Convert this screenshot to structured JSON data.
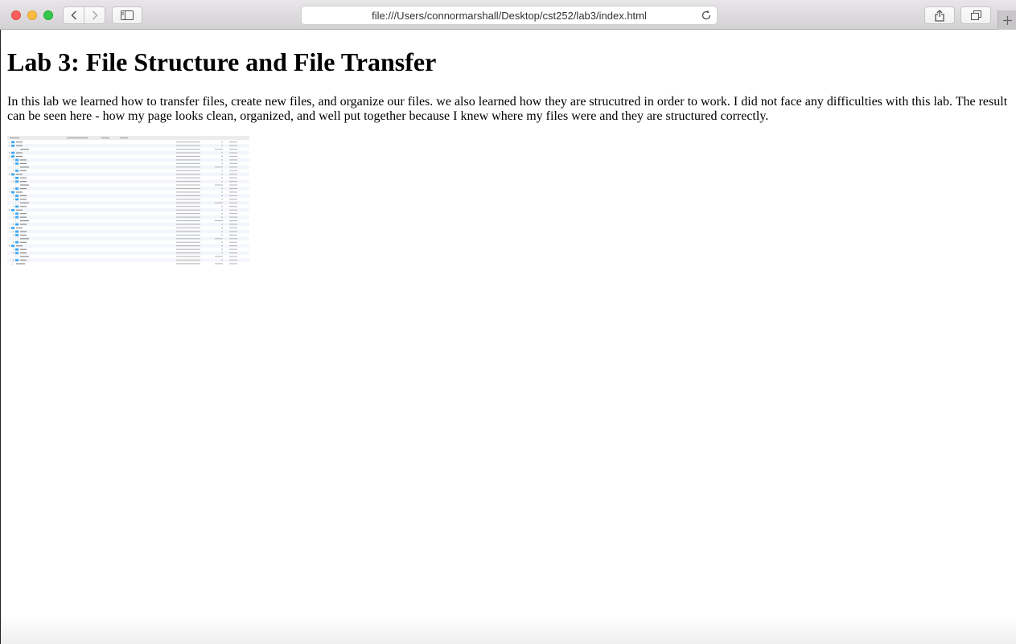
{
  "browser": {
    "url": "file:///Users/connormarshall/Desktop/cst252/lab3/index.html"
  },
  "page": {
    "heading": "Lab 3: File Structure and File Transfer",
    "paragraph": "In this lab we learned how to transfer files, create new files, and organize our files. we also learned how they are strucutred in order to work. I did not face any difficulties with this lab. The result can be seen here - how my page looks clean, organized, and well put together because I knew where my files were and they are structured correctly."
  },
  "screenshot_image": {
    "description_icon": "finder-file-listing-image",
    "rows": [
      {
        "depth": 0,
        "kind": "folder",
        "expanded": false
      },
      {
        "depth": 0,
        "kind": "folder",
        "expanded": true
      },
      {
        "depth": 1,
        "kind": "file"
      },
      {
        "depth": 0,
        "kind": "folder",
        "expanded": false
      },
      {
        "depth": 0,
        "kind": "folder",
        "expanded": true
      },
      {
        "depth": 1,
        "kind": "folder",
        "expanded": false
      },
      {
        "depth": 1,
        "kind": "folder",
        "expanded": false
      },
      {
        "depth": 1,
        "kind": "file"
      },
      {
        "depth": 1,
        "kind": "folder",
        "expanded": false
      },
      {
        "depth": 0,
        "kind": "folder",
        "expanded": true
      },
      {
        "depth": 1,
        "kind": "folder",
        "expanded": false
      },
      {
        "depth": 1,
        "kind": "folder",
        "expanded": false
      },
      {
        "depth": 1,
        "kind": "file"
      },
      {
        "depth": 1,
        "kind": "folder",
        "expanded": false
      },
      {
        "depth": 0,
        "kind": "folder",
        "expanded": true
      },
      {
        "depth": 1,
        "kind": "folder",
        "expanded": false
      },
      {
        "depth": 1,
        "kind": "folder",
        "expanded": false
      },
      {
        "depth": 1,
        "kind": "file"
      },
      {
        "depth": 1,
        "kind": "folder",
        "expanded": false
      },
      {
        "depth": 0,
        "kind": "folder",
        "expanded": true
      },
      {
        "depth": 1,
        "kind": "folder",
        "expanded": false
      },
      {
        "depth": 1,
        "kind": "folder",
        "expanded": false
      },
      {
        "depth": 1,
        "kind": "file"
      },
      {
        "depth": 1,
        "kind": "folder",
        "expanded": false
      },
      {
        "depth": 0,
        "kind": "folder",
        "expanded": true
      },
      {
        "depth": 1,
        "kind": "folder",
        "expanded": false
      },
      {
        "depth": 1,
        "kind": "folder",
        "expanded": false
      },
      {
        "depth": 1,
        "kind": "file"
      },
      {
        "depth": 1,
        "kind": "folder",
        "expanded": false
      },
      {
        "depth": 0,
        "kind": "folder",
        "expanded": true
      },
      {
        "depth": 1,
        "kind": "folder",
        "expanded": false
      },
      {
        "depth": 1,
        "kind": "folder",
        "expanded": false
      },
      {
        "depth": 1,
        "kind": "file"
      },
      {
        "depth": 1,
        "kind": "folder",
        "expanded": false
      },
      {
        "depth": 0,
        "kind": "file"
      }
    ]
  },
  "colors": {
    "folder": "#3da8f5",
    "file": "#d8d8d8",
    "faint_text": "#b8b8b8"
  }
}
